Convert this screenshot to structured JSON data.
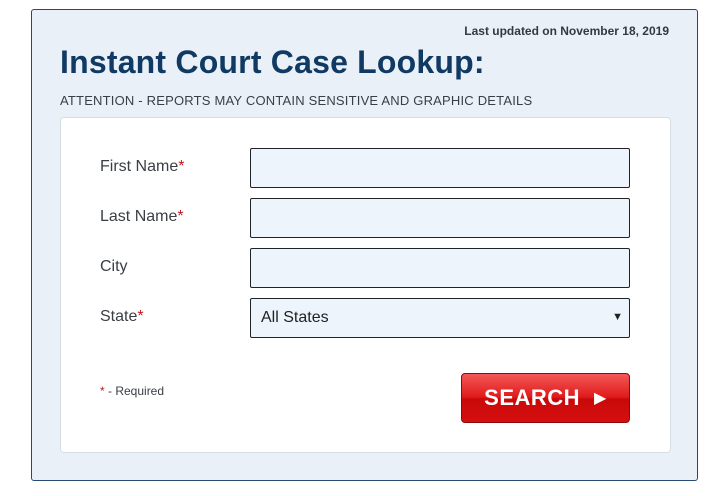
{
  "header": {
    "last_updated": "Last updated on November 18, 2019",
    "title": "Instant Court Case Lookup:",
    "attention": "ATTENTION - REPORTS MAY CONTAIN SENSITIVE AND GRAPHIC DETAILS"
  },
  "form": {
    "first_name_label": "First Name",
    "last_name_label": "Last Name",
    "city_label": "City",
    "state_label": "State",
    "required_marker": "*",
    "first_name_value": "",
    "last_name_value": "",
    "city_value": "",
    "state_selected": "All States",
    "state_arrow_icon": "dropdown-triangle-icon"
  },
  "footer": {
    "required_marker": "*",
    "required_note": " - Required",
    "search_label": "SEARCH",
    "search_icon": "play-arrow-icon"
  },
  "colors": {
    "panel_bg": "#e9f0f7",
    "title": "#103a63",
    "required": "#c0161e",
    "button": "#e01b1b",
    "field_bg": "#eef4fb"
  }
}
